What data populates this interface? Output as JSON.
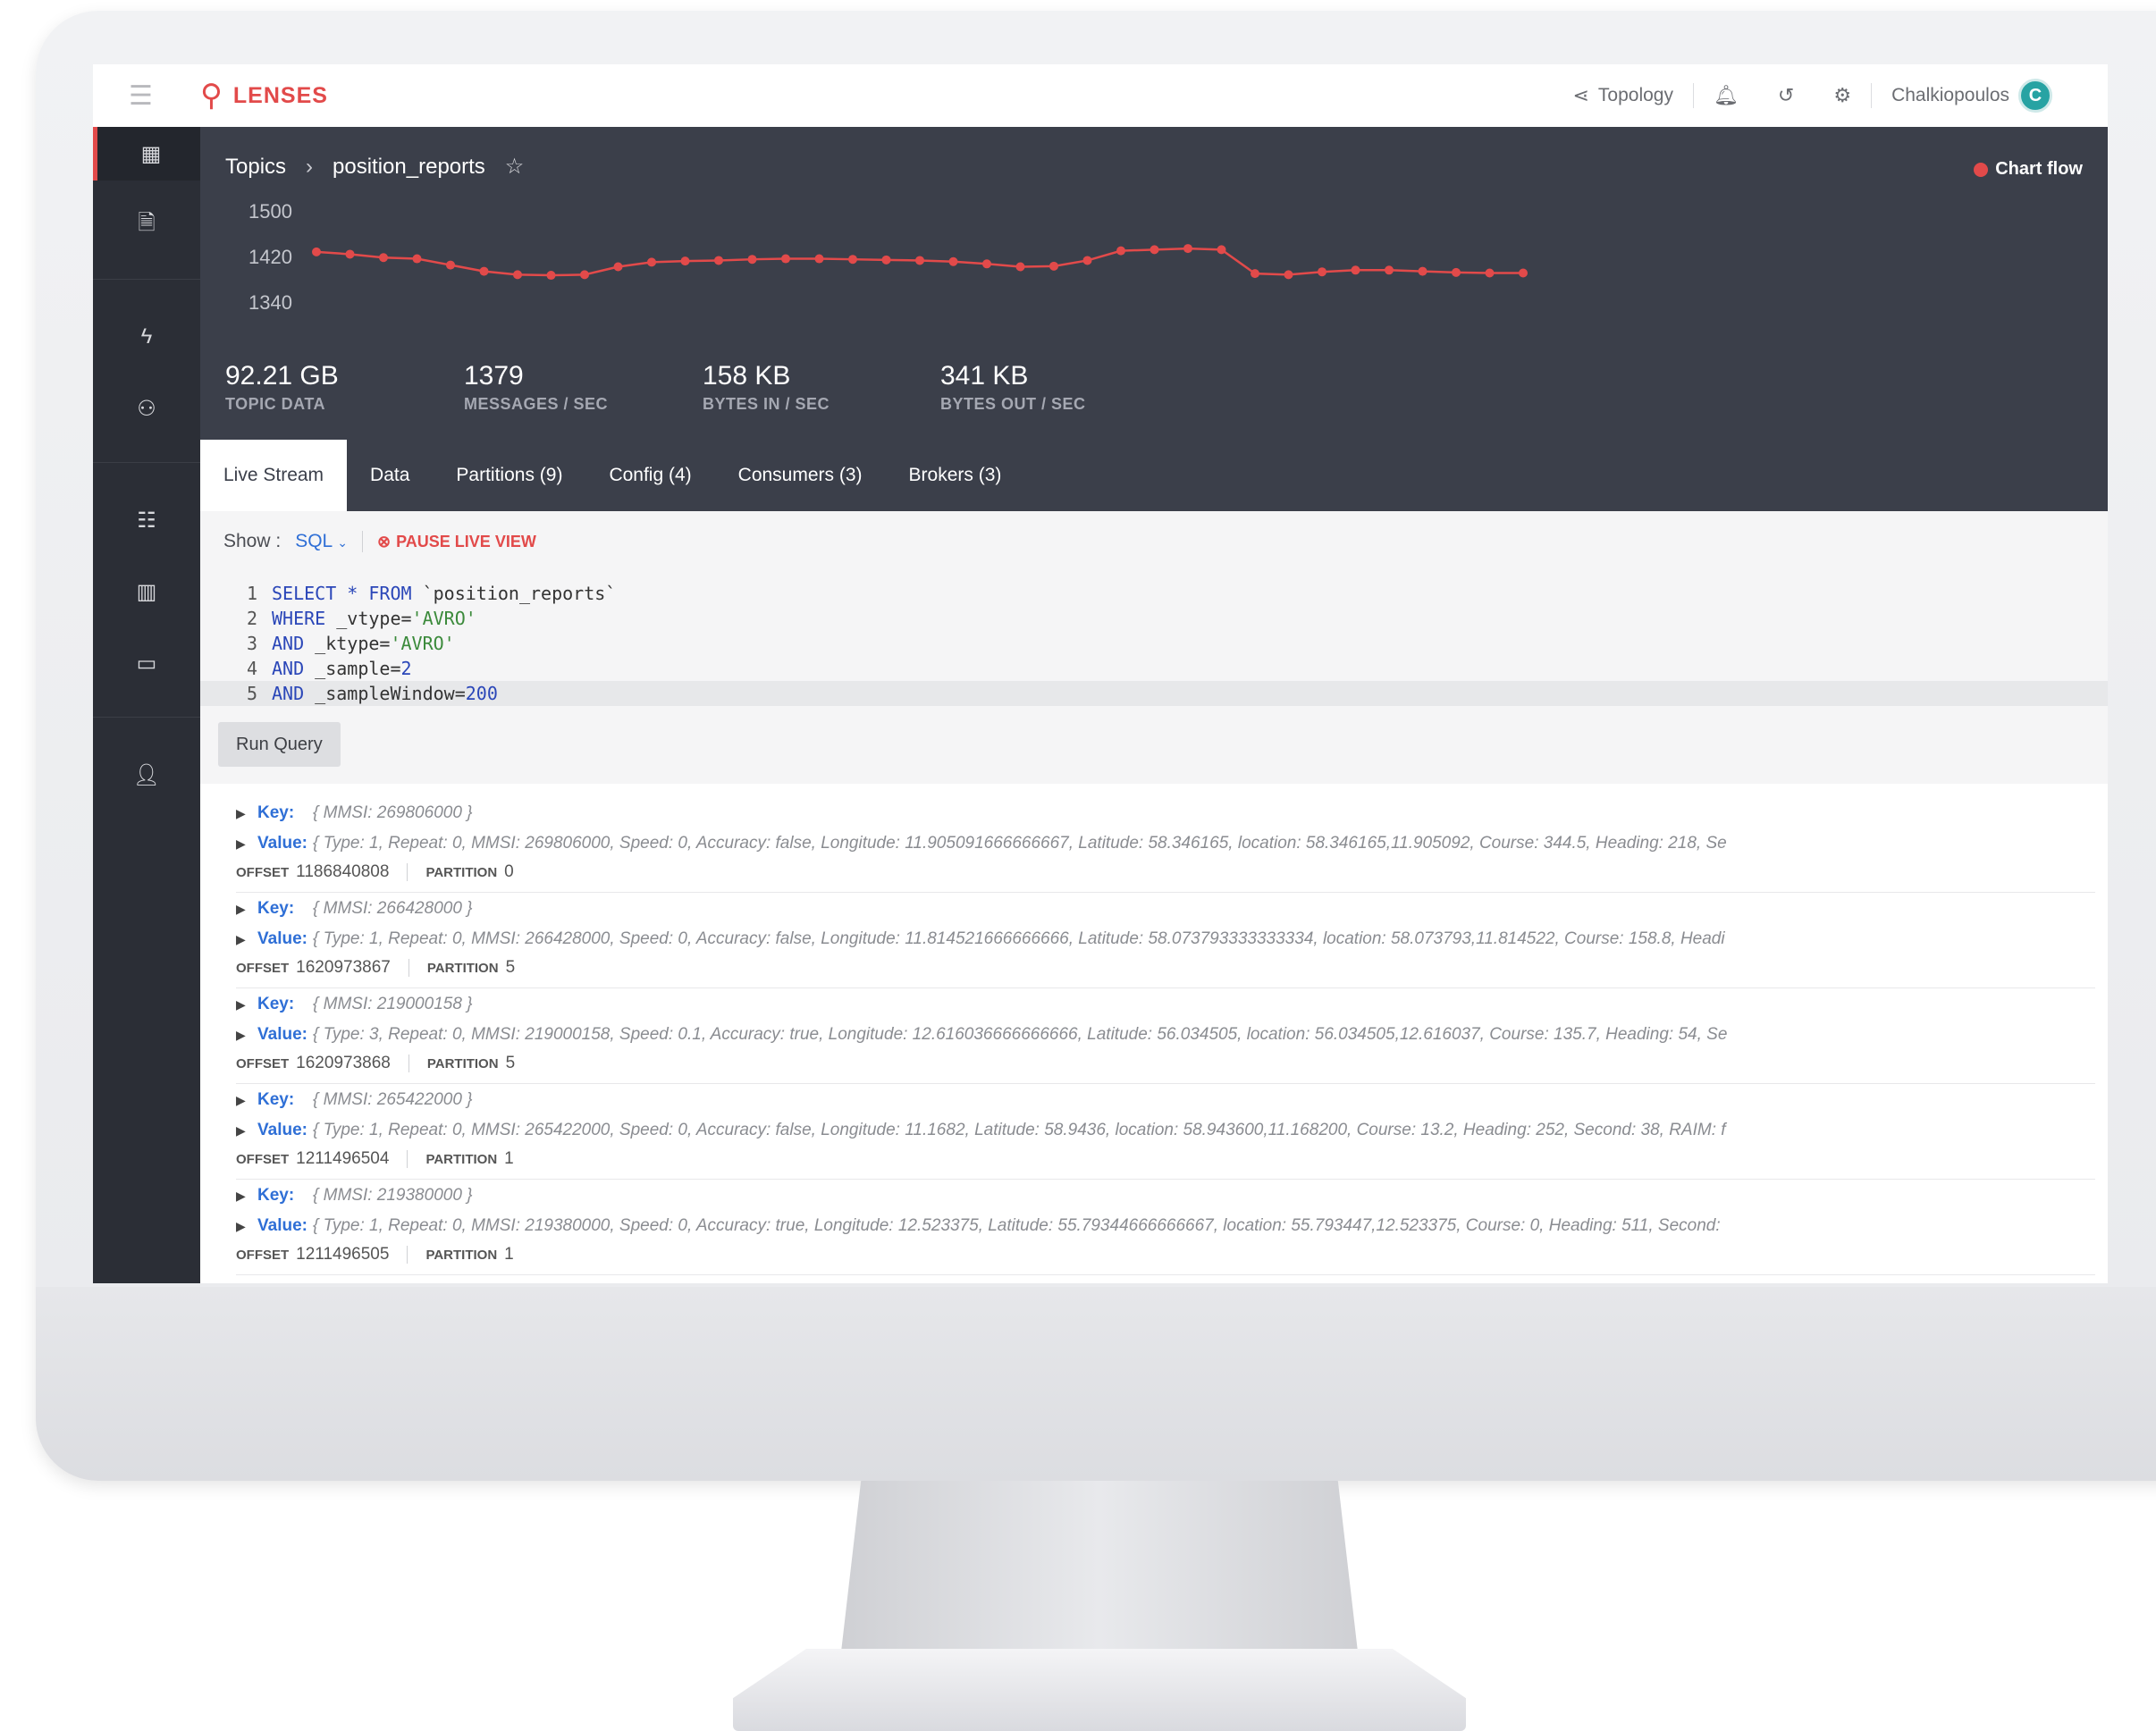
{
  "app": {
    "logo_text": "LENSES"
  },
  "topbar": {
    "topology_label": "Topology",
    "username": "Chalkiopoulos",
    "avatar_letter": "C"
  },
  "breadcrumb": {
    "root": "Topics",
    "separator": "›",
    "topic": "position_reports"
  },
  "chart_flow_label": "Chart flow",
  "chart_data": {
    "type": "line",
    "y_ticks": [
      "1500",
      "1420",
      "1340"
    ],
    "ylim": [
      1340,
      1500
    ],
    "values": [
      1428,
      1424,
      1418,
      1416,
      1405,
      1394,
      1388,
      1387,
      1388,
      1402,
      1410,
      1412,
      1413,
      1415,
      1416,
      1416,
      1415,
      1414,
      1413,
      1411,
      1407,
      1402,
      1403,
      1413,
      1430,
      1432,
      1434,
      1432,
      1390,
      1388,
      1393,
      1396,
      1396,
      1394,
      1392,
      1391,
      1391
    ],
    "color": "#e24a4a"
  },
  "stats": [
    {
      "value": "92.21 GB",
      "label": "TOPIC DATA"
    },
    {
      "value": "1379",
      "label": "MESSAGES / SEC"
    },
    {
      "value": "158 KB",
      "label": "BYTES IN / SEC"
    },
    {
      "value": "341 KB",
      "label": "BYTES OUT / SEC"
    }
  ],
  "tabs": [
    "Live Stream",
    "Data",
    "Partitions (9)",
    "Config (4)",
    "Consumers (3)",
    "Brokers (3)"
  ],
  "query": {
    "show_label": "Show :",
    "show_value": "SQL",
    "pause_label": "PAUSE LIVE VIEW",
    "run_label": "Run Query",
    "lines": [
      {
        "n": "1",
        "kw": "SELECT * FROM",
        "rest": " `position_reports`"
      },
      {
        "n": "2",
        "kw": "WHERE",
        "plain": " _vtype=",
        "str": "'AVRO'"
      },
      {
        "n": "3",
        "kw": "AND",
        "plain": " _ktype=",
        "str": "'AVRO'"
      },
      {
        "n": "4",
        "kw": "AND",
        "plain": " _sample=",
        "num": "2"
      },
      {
        "n": "5",
        "kw": "AND",
        "plain": " _sampleWindow=",
        "num": "200"
      }
    ]
  },
  "records_labels": {
    "key": "Key:",
    "value": "Value:",
    "offset": "OFFSET",
    "partition": "PARTITION"
  },
  "records": [
    {
      "key": "{ MMSI: 269806000 }",
      "value": "{ Type: 1, Repeat: 0, MMSI: 269806000, Speed: 0, Accuracy: false, Longitude: 11.905091666666667, Latitude: 58.346165, location: 58.346165,11.905092, Course: 344.5, Heading: 218, Se",
      "offset": "1186840808",
      "partition": "0"
    },
    {
      "key": "{ MMSI: 266428000 }",
      "value": "{ Type: 1, Repeat: 0, MMSI: 266428000, Speed: 0, Accuracy: false, Longitude: 11.814521666666666, Latitude: 58.073793333333334, location: 58.073793,11.814522, Course: 158.8, Headi",
      "offset": "1620973867",
      "partition": "5"
    },
    {
      "key": "{ MMSI: 219000158 }",
      "value": "{ Type: 3, Repeat: 0, MMSI: 219000158, Speed: 0.1, Accuracy: true, Longitude: 12.616036666666666, Latitude: 56.034505, location: 56.034505,12.616037, Course: 135.7, Heading: 54, Se",
      "offset": "1620973868",
      "partition": "5"
    },
    {
      "key": "{ MMSI: 265422000 }",
      "value": "{ Type: 1, Repeat: 0, MMSI: 265422000, Speed: 0, Accuracy: false, Longitude: 11.1682, Latitude: 58.9436, location: 58.943600,11.168200, Course: 13.2, Heading: 252, Second: 38, RAIM: f",
      "offset": "1211496504",
      "partition": "1"
    },
    {
      "key": "{ MMSI: 219380000 }",
      "value": "{ Type: 1, Repeat: 0, MMSI: 219380000, Speed: 0, Accuracy: true, Longitude: 12.523375, Latitude: 55.79344666666667, location: 55.793447,12.523375, Course: 0, Heading: 511, Second:",
      "offset": "1211496505",
      "partition": "1"
    }
  ]
}
